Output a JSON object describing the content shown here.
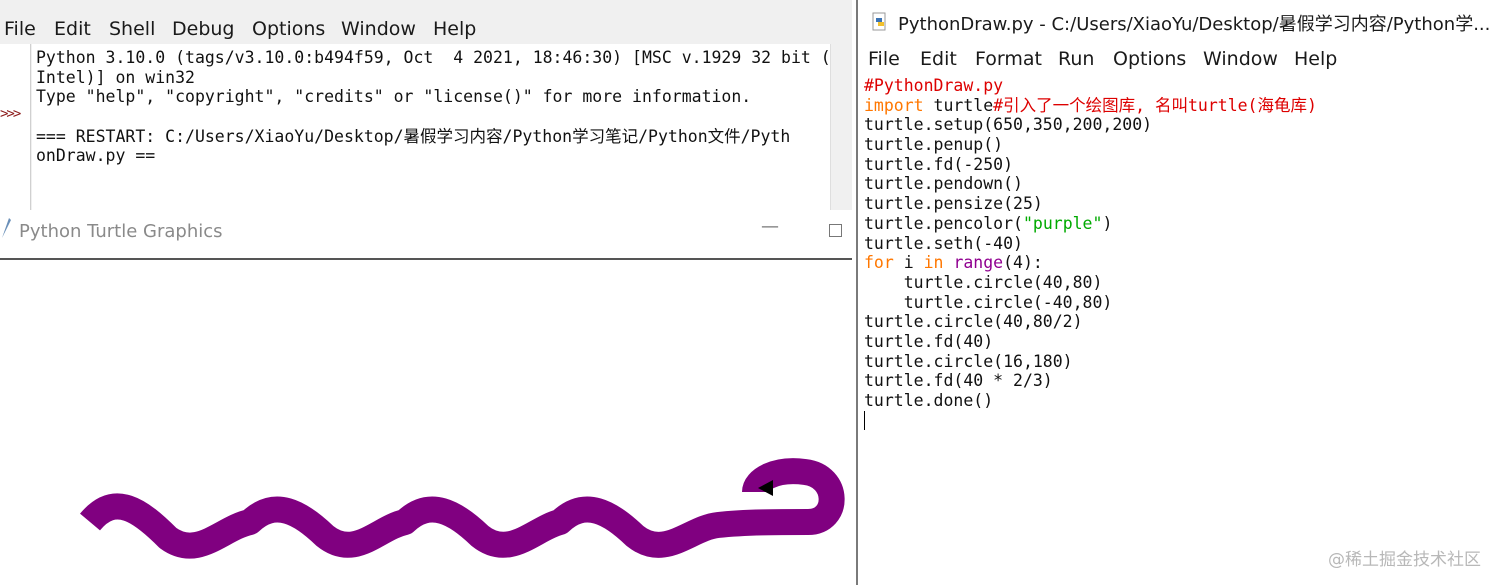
{
  "shell": {
    "menu": [
      "File",
      "Edit",
      "Shell",
      "Debug",
      "Options",
      "Window",
      "Help"
    ],
    "prompt": ">>>",
    "lines": [
      "Python 3.10.0 (tags/v3.10.0:b494f59, Oct  4 2021, 18:46:30) [MSC v.1929 32 bit (",
      "Intel)] on win32",
      "Type \"help\", \"copyright\", \"credits\" or \"license()\" for more information.",
      "",
      "=== RESTART: C:/Users/XiaoYu/Desktop/暑假学习内容/Python学习笔记/Python文件/Pyth",
      "onDraw.py =="
    ]
  },
  "turtle_window": {
    "title": "Python Turtle Graphics",
    "minimize_glyph": "—",
    "pen_color": "#800080"
  },
  "editor": {
    "title": "PythonDraw.py - C:/Users/XiaoYu/Desktop/暑假学习内容/Python学...",
    "menu": [
      "File",
      "Edit",
      "Format",
      "Run",
      "Options",
      "Window",
      "Help"
    ],
    "code": {
      "l1": "#PythonDraw.py",
      "l2_kw": "import",
      "l2_rest": " turtle",
      "l2_comment": "#引入了一个绘图库, 名叫turtle(海龟库)",
      "l3": "turtle.setup(650,350,200,200)",
      "l4": "turtle.penup()",
      "l5": "turtle.fd(-250)",
      "l6": "turtle.pendown()",
      "l7": "turtle.pensize(25)",
      "l8_a": "turtle.pencolor(",
      "l8_str": "\"purple\"",
      "l8_b": ")",
      "l9": "turtle.seth(-40)",
      "l10_kw1": "for",
      "l10_var": " i ",
      "l10_kw2": "in",
      "l10_sp": " ",
      "l10_builtin": "range",
      "l10_rest": "(4):",
      "l11": "    turtle.circle(40,80)",
      "l12": "    turtle.circle(-40,80)",
      "l13": "turtle.circle(40,80/2)",
      "l14": "turtle.fd(40)",
      "l15": "turtle.circle(16,180)",
      "l16": "turtle.fd(40 * 2/3)",
      "l17": "turtle.done()"
    }
  },
  "watermark": "@稀土掘金技术社区",
  "colors": {
    "comment": "#dd0000",
    "keyword": "#ff7700",
    "string": "#00aa00",
    "builtin": "#900090"
  }
}
